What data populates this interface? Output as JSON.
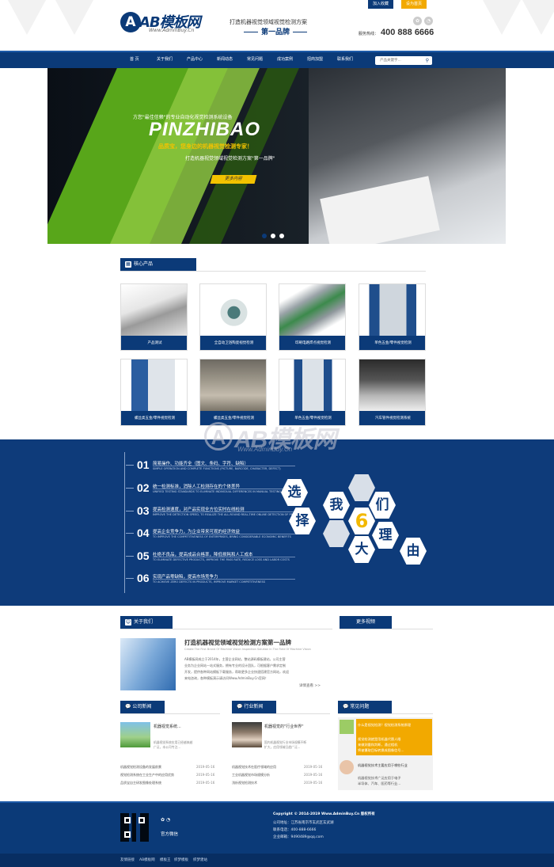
{
  "header": {
    "logo_mark": "A",
    "logo_text": "AB模板网",
    "logo_sub": "Www.AdminBuy.Cn",
    "slogan_line1": "打造机器视觉领域视觉检测方案",
    "slogan_line2": "第一品牌",
    "btn_home": "加入收藏",
    "btn_fav": "设为首页",
    "phone_label": "服务热线：",
    "phone": "400 888 6666"
  },
  "nav": {
    "items": [
      "首 页",
      "关于我们",
      "产品中心",
      "新闻动态",
      "常见问题",
      "成功案例",
      "招商加盟",
      "联系我们"
    ],
    "search_placeholder": "产品关键字..."
  },
  "banner": {
    "small": "方您\"最佳信赖\"的专业自动化视觉检测系统设备",
    "big": "PINZHIBAO",
    "slogan": "品质宝，您身边的机器视觉检测专家！",
    "slogan2": "打造机器视觉领域视觉检测方案\"第一品牌\"",
    "button": "更多内容"
  },
  "products": {
    "title": "核心产品",
    "items": [
      {
        "caption": "产品测试"
      },
      {
        "caption": "全自动卫浴陶瓷视觉检测"
      },
      {
        "caption": "印刷电路焊点视觉检测"
      },
      {
        "caption": "单色五金/零件视觉检测"
      },
      {
        "caption": "螺丝类五金/零件视觉检测"
      },
      {
        "caption": "螺丝类五金/零件视觉检测"
      },
      {
        "caption": "单色五金/零件视觉检测"
      },
      {
        "caption": "汽车管件视觉检测系统"
      }
    ]
  },
  "watermark": {
    "mark": "A",
    "text": "AB模板网",
    "sub": "Www.AdminBuy.Cn"
  },
  "why": {
    "rows": [
      {
        "num": "01",
        "text": "简易操作、功能齐全（图文、条码、字符、缺陷）",
        "sub": "SIMPLE OPERATION AND COMPLETE FUNCTIONS (PICTURE, BARCODE, CHARACTER, DEFECT)"
      },
      {
        "num": "02",
        "text": "统一检测标准，消除人工检测存在的个体差异",
        "sub": "UNIFIED TESTING STANDARDS TO ELIMINATE INDIVIDUAL DIFFERENCES IN MANUAL TESTING"
      },
      {
        "num": "03",
        "text": "提高检测速度，对产品实现全方位实时在线检测",
        "sub": "IMPROVE THE DETECTION SPEED, TO REALIZE THE ALL-ROUND REAL-TIME ONLINE DETECTION OF PRODUCTS"
      },
      {
        "num": "04",
        "text": "提高企业竞争力，为企业带来可观的经济效益",
        "sub": "TO IMPROVE THE COMPETITIVENESS OF ENTERPRISES, BRING CONSIDERABLE ECONOMIC BENEFITS"
      },
      {
        "num": "05",
        "text": "杜绝不良品，提高成品合格率，降低损耗和人工成本",
        "sub": "TO ELIMINATE DEFECTIVE PRODUCTS, IMPROVE THE PASS RATE, REDUCE LOSS AND LABOR COSTS"
      },
      {
        "num": "06",
        "text": "实现产品零缺陷，提高市场竞争力",
        "sub": "TO ACHIEVE ZERO DEFECTS IN PRODUCTS, IMPROVE MARKET COMPETITIVENESS"
      }
    ],
    "hex": [
      "选",
      "择",
      "我",
      "们",
      "6",
      "大",
      "理",
      "由"
    ]
  },
  "about": {
    "title": "关于我们",
    "headline": "打造机器视觉领域视觉检测方案第一品牌",
    "sub": "Create The First Brand Of Machine Vision Inspection Solution In The Field Of Machine Vision",
    "p1": "AB模板网成立于2014年，主营企业网站、整站源码模板建站，公司主营",
    "p2": "业务为企业网站一站式服务，拥有专业的设计团队，可根据客户需求定制",
    "p3": "开发，提供各种网站模板下载服务，帮助更多企业快速搭建官方网站，欢迎",
    "p4": "来电咨询，各种模板演示请访问Www.AdminBuy.Cn官网！",
    "more": "详情查看 >>"
  },
  "video": {
    "title": "更多视频"
  },
  "news1": {
    "title": "公司新闻",
    "top_title": "机器视觉系统...",
    "top_desc1": "机器视觉系统应用已经越来越",
    "top_desc2": "广泛，本公司专注...",
    "list": [
      {
        "t": "机器视觉检测设备的发展前景",
        "d": "2019-05-16"
      },
      {
        "t": "视觉检测系统在工业生产中的应用优势",
        "d": "2019-05-16"
      },
      {
        "t": "品质宝自主研发图像处理系统",
        "d": "2019-05-16"
      }
    ]
  },
  "news2": {
    "title": "行业新闻",
    "top_title": "机器视觉的\"行业世界\"",
    "top_desc1": "国内机器视觉行业市场规模不断",
    "top_desc2": "扩大，应用领域日趋广泛...",
    "list": [
      {
        "t": "机器视觉技术在医疗领域的应用",
        "d": "2019-05-16"
      },
      {
        "t": "工业机器视觉市场规模分析",
        "d": "2019-05-16"
      },
      {
        "t": "浅析视觉检测技术",
        "d": "2019-05-16"
      }
    ]
  },
  "faq": {
    "title": "常见问题",
    "q1": "什么是视觉检测？视觉检测系统原理",
    "a1a": "视觉检测就是用机器代替人眼",
    "a1b": "来做测量和判断，通过相机",
    "a1c": "将被摄取目标转换成图像信号...",
    "q2": "机器视觉技术主要应用于哪些行业",
    "a2a": "机器视觉技术广泛应用于电子",
    "a2b": "半导体、汽车、医药等行业..."
  },
  "footer": {
    "wechat": "官方微信",
    "copyright": "Copyright © 2014-2019 Www.AdminBuy.Cn 版权所有",
    "address": "公司地址：江苏省南京市玄武区玄武湖",
    "phone": "联系电话：400-888-6666",
    "email": "企业邮箱：9490489@qq.com"
  },
  "bottom_links": [
    "友情链接",
    "AB模板网",
    "模板王",
    "织梦模板",
    "织梦建站"
  ]
}
